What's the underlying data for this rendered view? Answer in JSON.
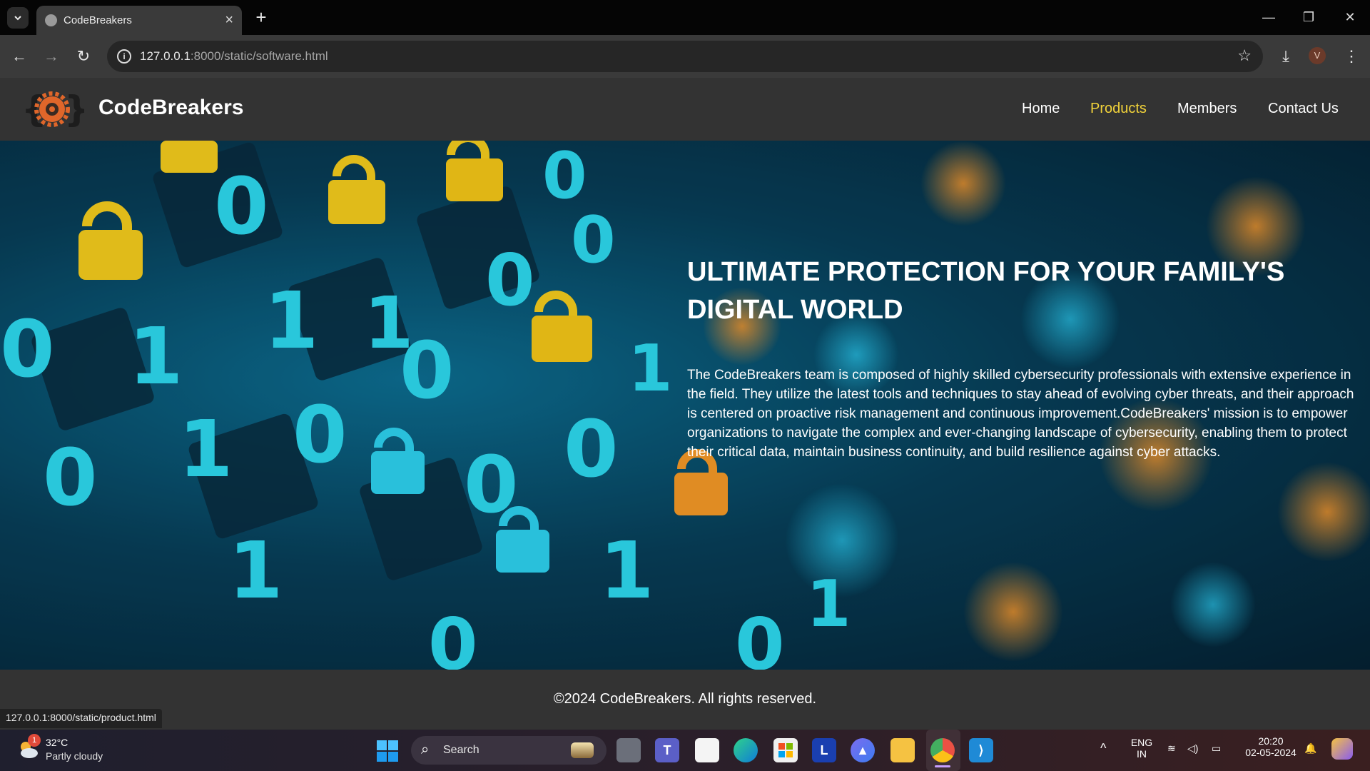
{
  "browser": {
    "tab_title": "CodeBreakers",
    "url_host": "127.0.0.1",
    "url_rest": ":8000/static/software.html",
    "profile_initial": "V",
    "status_url": "127.0.0.1:8000/static/product.html"
  },
  "site": {
    "brand": "CodeBreakers",
    "nav": [
      {
        "label": "Home",
        "active": false
      },
      {
        "label": "Products",
        "active": true
      },
      {
        "label": "Members",
        "active": false
      },
      {
        "label": "Contact Us",
        "active": false
      }
    ],
    "hero_title": "ULTIMATE PROTECTION FOR YOUR FAMILY'S DIGITAL WORLD",
    "hero_text": "The CodeBreakers team is composed of highly skilled cybersecurity professionals with extensive experience in the field. They utilize the latest tools and techniques to stay ahead of evolving cyber threats, and their approach is centered on proactive risk management and continuous improvement.CodeBreakers' mission is to empower organizations to navigate the complex and ever-changing landscape of cybersecurity, enabling them to protect their critical data, maintain business continuity, and build resilience against cyber attacks.",
    "footer": "©2024 CodeBreakers. All rights reserved.",
    "active_color": "#f2d33a"
  },
  "taskbar": {
    "weather_badge": "1",
    "temperature": "32°C",
    "condition": "Partly cloudy",
    "search_label": "Search",
    "lang_line1": "ENG",
    "lang_line2": "IN",
    "time": "20:20",
    "date": "02-05-2024",
    "apps": [
      "task-view",
      "teams",
      "notepad",
      "edge",
      "store",
      "l-app",
      "arc-app",
      "file-explorer",
      "chrome",
      "vscode"
    ]
  }
}
